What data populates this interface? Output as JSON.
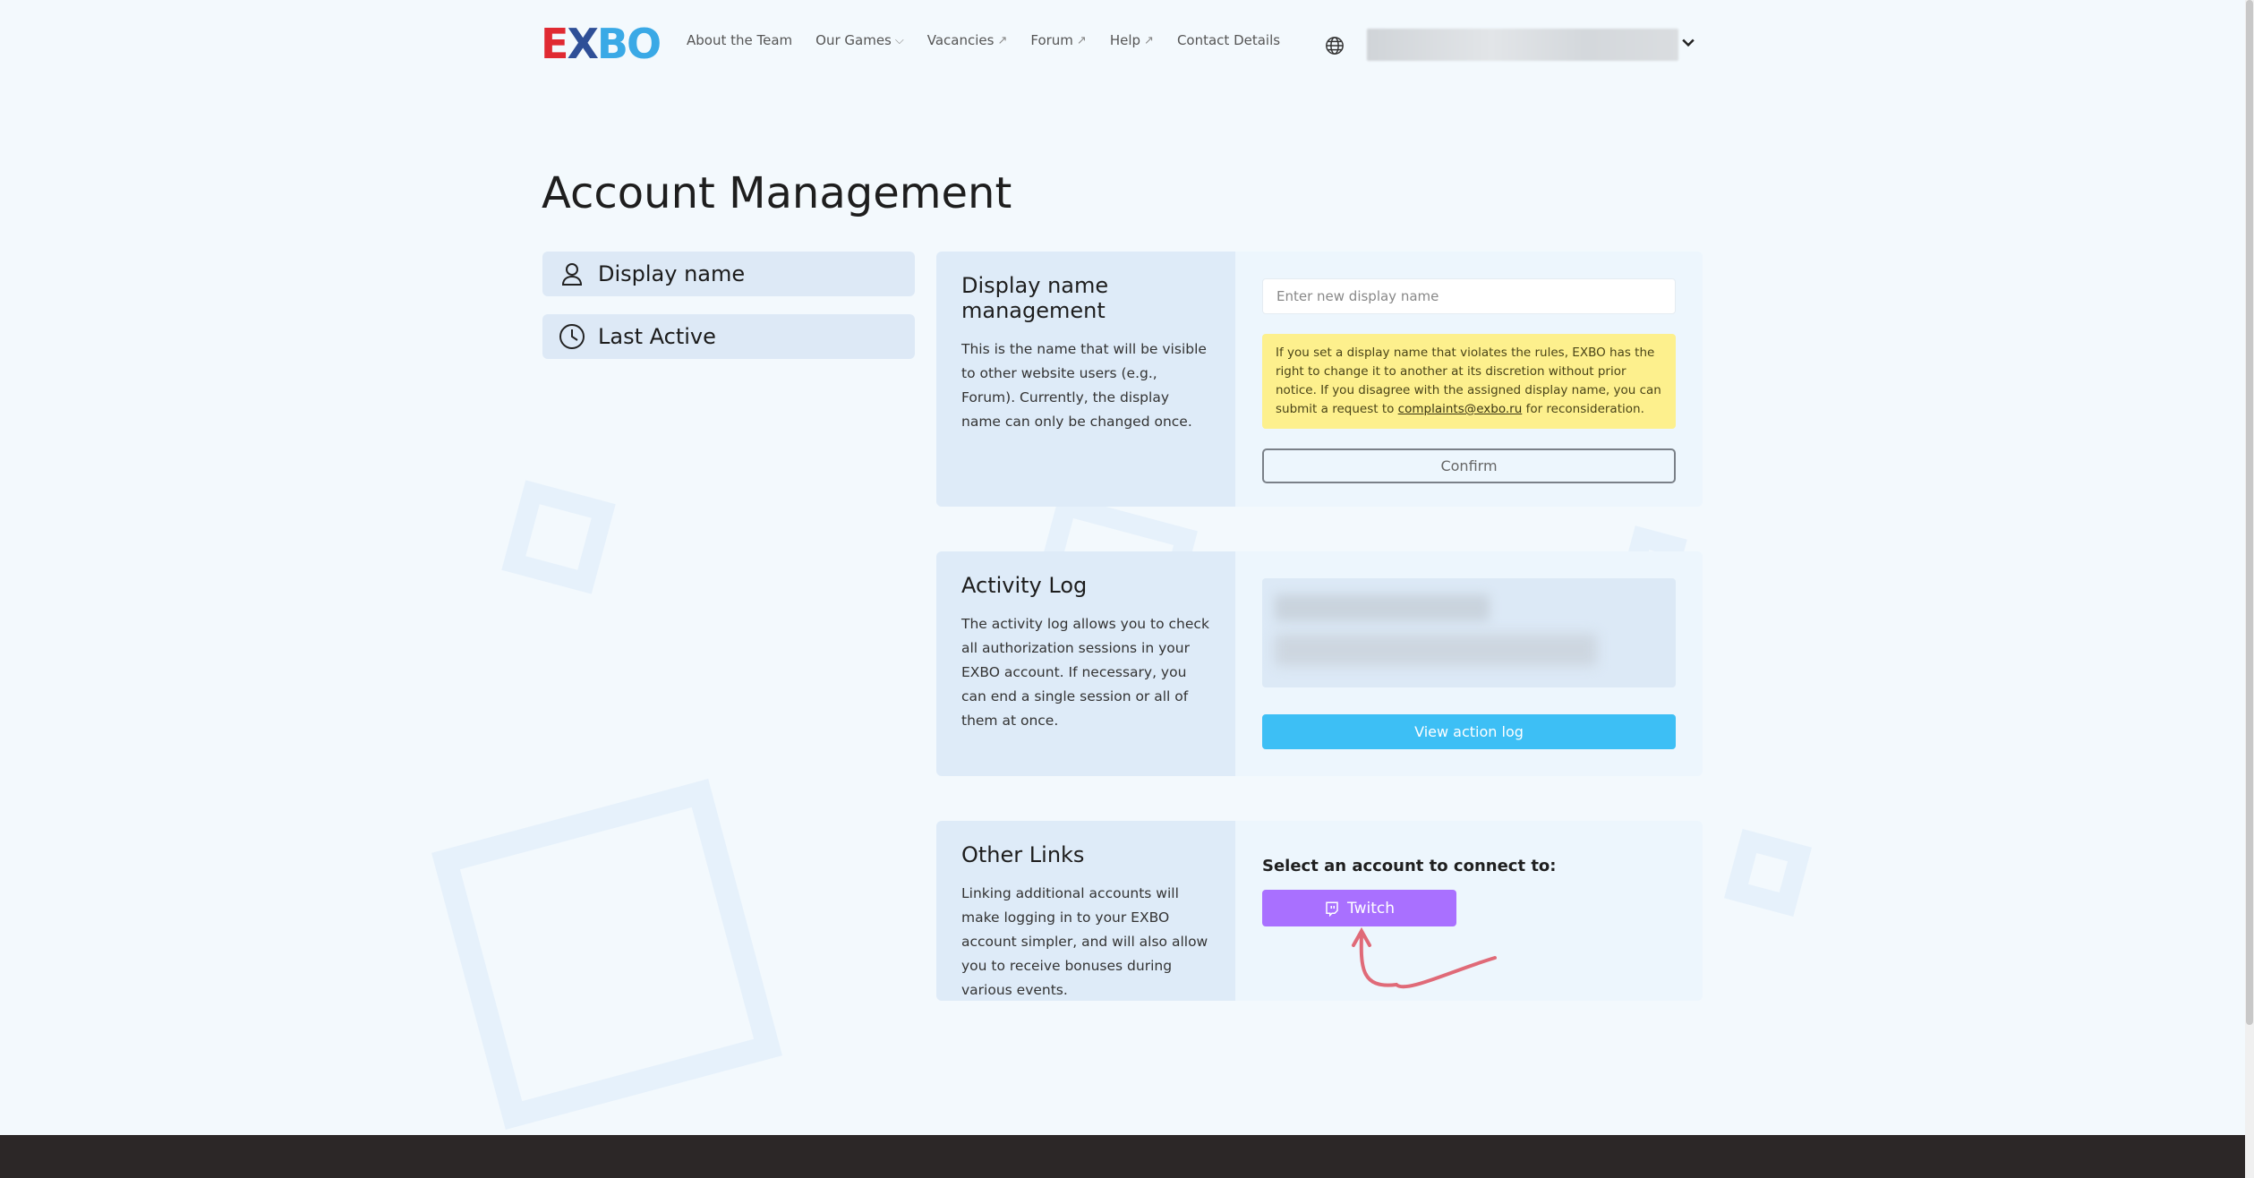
{
  "header": {
    "logo": {
      "left": "E",
      "middle": "X",
      "right": "BO"
    },
    "nav": [
      {
        "label": "About the Team",
        "suffix": ""
      },
      {
        "label": "Our Games",
        "suffix": "⌵"
      },
      {
        "label": "Vacancies",
        "suffix": "↗"
      },
      {
        "label": "Forum",
        "suffix": "↗"
      },
      {
        "label": "Help",
        "suffix": "↗"
      },
      {
        "label": "Contact Details",
        "suffix": ""
      }
    ]
  },
  "page_title": "Account Management",
  "sidebar": {
    "items": [
      {
        "label": "Display name",
        "icon": "user-icon"
      },
      {
        "label": "Last Active",
        "icon": "clock-icon"
      }
    ]
  },
  "display_name_card": {
    "title": "Display name management",
    "description": "This is the name that will be visible to other website users (e.g., Forum). Currently, the display name can only be changed once.",
    "input_placeholder": "Enter new display name",
    "warning_before": "If you set a display name that violates the rules, EXBO has the right to change it to another at its discretion without prior notice. If you disagree with the assigned display name, you can submit a request to ",
    "warning_email": "complaints@exbo.ru",
    "warning_after": " for reconsideration.",
    "confirm_label": "Confirm"
  },
  "activity_card": {
    "title": "Activity Log",
    "description": "The activity log allows you to check all authorization sessions in your EXBO account. If necessary, you can end a single session or all of them at once.",
    "button_label": "View action log"
  },
  "links_card": {
    "title": "Other Links",
    "description": "Linking additional accounts will make logging in to your EXBO account simpler, and will also allow you to receive bonuses during various events.",
    "connect_label": "Select an account to connect to:",
    "twitch_label": "Twitch"
  },
  "colors": {
    "accent_blue": "#3dbff5",
    "twitch_purple": "#a970ff",
    "warning_yellow": "#fdf08d",
    "annotation_red": "#e06a78"
  }
}
